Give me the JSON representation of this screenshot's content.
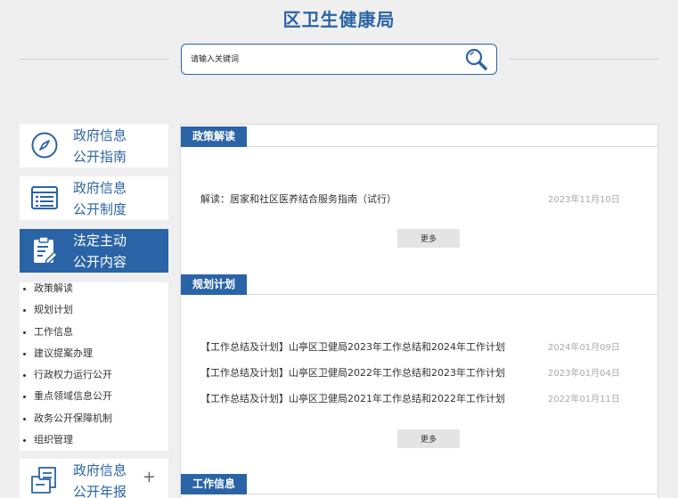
{
  "header": {
    "title": "区卫生健康局"
  },
  "search": {
    "placeholder": "请输入关键词"
  },
  "sidebar": {
    "cards": [
      {
        "label_line1": "政府信息",
        "label_line2": "公开指南",
        "icon": "compass-icon"
      },
      {
        "label_line1": "政府信息",
        "label_line2": "公开制度",
        "icon": "document-list-icon"
      },
      {
        "label_line1": "法定主动",
        "label_line2": "公开内容",
        "icon": "edit-document-icon"
      },
      {
        "label_line1": "政府信息",
        "label_line2": "公开年报",
        "icon": "folder-document-icon",
        "expand": "+"
      }
    ],
    "sub_items": [
      "政策解读",
      "规划计划",
      "工作信息",
      "建议提案办理",
      "行政权力运行公开",
      "重点领域信息公开",
      "政务公开保障机制",
      "组织管理"
    ]
  },
  "main": {
    "sections": [
      {
        "title": "政策解读",
        "items": [
          {
            "title": "解读：居家和社区医养结合服务指南（试行）",
            "date": "2023年11月10日"
          }
        ],
        "more": "更多"
      },
      {
        "title": "规划计划",
        "items": [
          {
            "title": "【工作总结及计划】山亭区卫健局2023年工作总结和2024年工作计划",
            "date": "2024年01月09日"
          },
          {
            "title": "【工作总结及计划】山亭区卫健局2022年工作总结和2023年工作计划",
            "date": "2023年01月04日"
          },
          {
            "title": "【工作总结及计划】山亭区卫健局2021年工作总结和2022年工作计划",
            "date": "2022年01月11日"
          }
        ],
        "more": "更多"
      },
      {
        "title": "工作信息"
      }
    ]
  },
  "colors": {
    "brand": "#2b64a6",
    "background": "#efefef"
  }
}
